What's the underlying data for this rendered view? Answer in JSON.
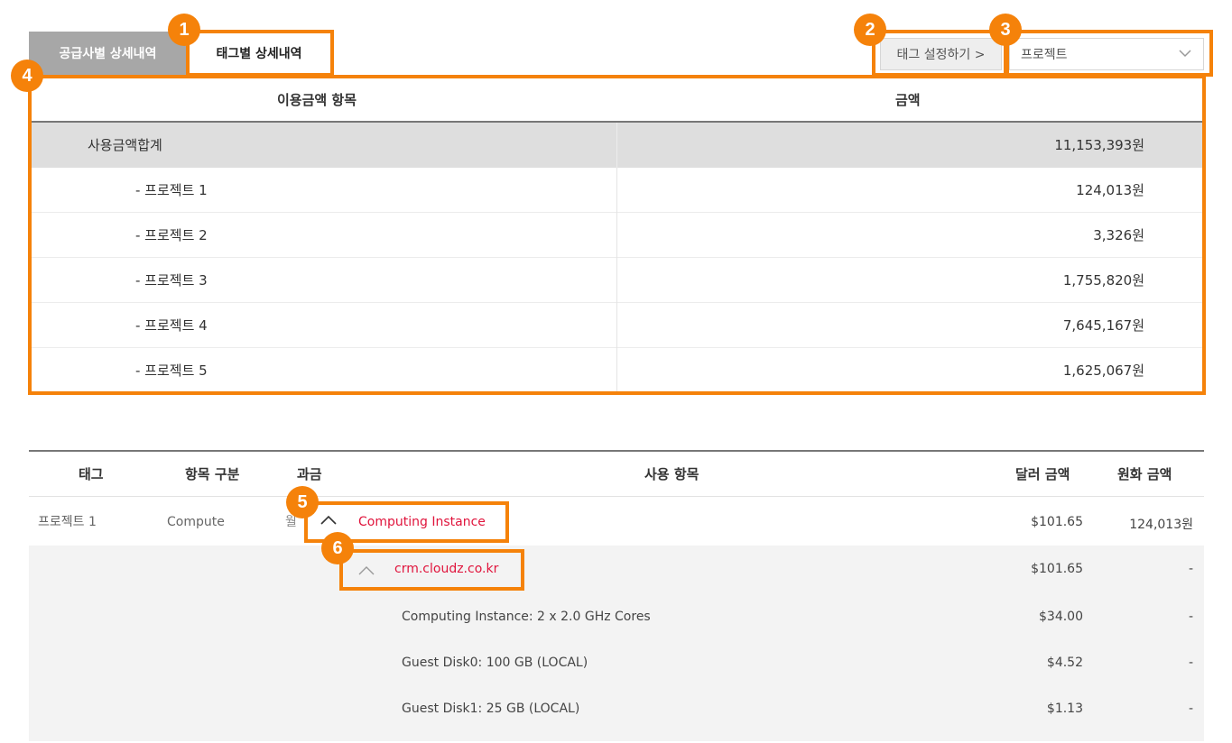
{
  "tabs": {
    "supplier": "공급사별 상세내역",
    "tag": "태그별 상세내역"
  },
  "toolbar": {
    "tag_settings_button": "태그 설정하기 >",
    "project_select": "프로젝트"
  },
  "summary_table": {
    "headers": [
      "이용금액 항목",
      "금액"
    ],
    "total": {
      "label": "사용금액합계",
      "amount": "11,153,393원"
    },
    "rows": [
      {
        "label": "- 프로젝트 1",
        "amount": "124,013원"
      },
      {
        "label": "- 프로젝트 2",
        "amount": "3,326원"
      },
      {
        "label": "- 프로젝트 3",
        "amount": "1,755,820원"
      },
      {
        "label": "- 프로젝트 4",
        "amount": "7,645,167원"
      },
      {
        "label": "- 프로젝트 5",
        "amount": "1,625,067원"
      }
    ]
  },
  "detail_table": {
    "headers": [
      "태그",
      "항목 구분",
      "과금",
      "사용 항목",
      "달러 금액",
      "원화 금액"
    ],
    "rows": [
      {
        "tag": "프로젝트 1",
        "category": "Compute",
        "billing": "월",
        "item": "Computing Instance",
        "usd": "$101.65",
        "krw": "124,013원"
      },
      {
        "item": "crm.cloudz.co.kr",
        "usd": "$101.65",
        "krw": "-"
      },
      {
        "item": "Computing Instance: 2 x 2.0 GHz Cores",
        "usd": "$34.00",
        "krw": "-"
      },
      {
        "item": "Guest Disk0: 100 GB (LOCAL)",
        "usd": "$4.52",
        "krw": "-"
      },
      {
        "item": "Guest Disk1: 25 GB (LOCAL)",
        "usd": "$1.13",
        "krw": "-"
      }
    ]
  },
  "annotations": [
    "1",
    "2",
    "3",
    "4",
    "5",
    "6"
  ],
  "colors": {
    "annotation": "#f5820a",
    "link": "#e0143c",
    "tab_inactive": "#a7a7a7",
    "total_row": "#dedede"
  }
}
